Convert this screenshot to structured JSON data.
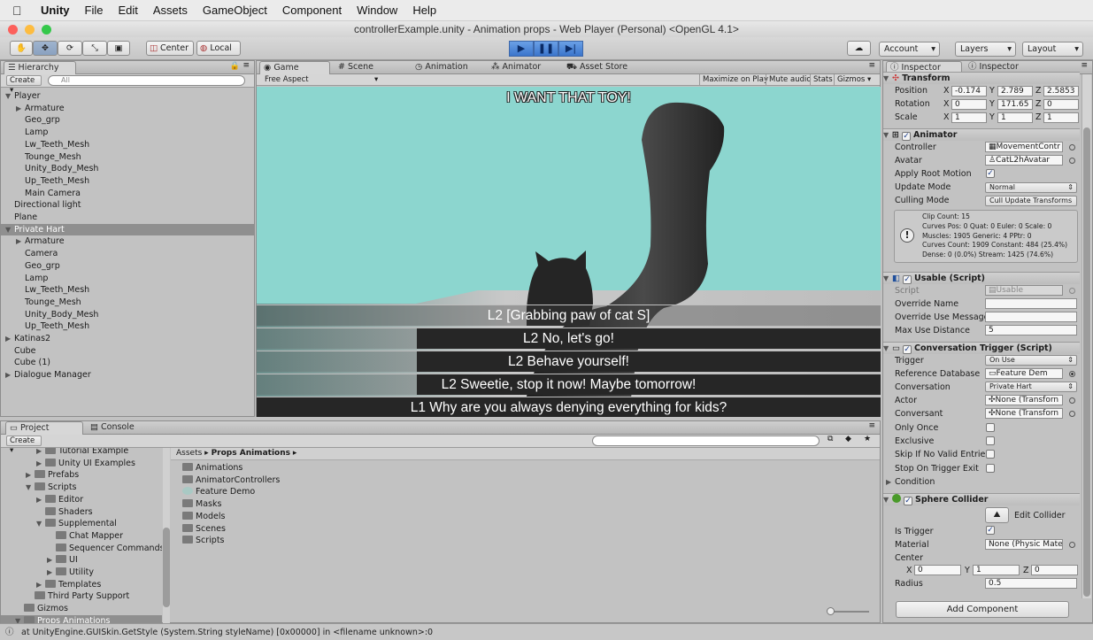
{
  "menubar": {
    "apple": "",
    "app": "Unity",
    "items": [
      "File",
      "Edit",
      "Assets",
      "GameObject",
      "Component",
      "Window",
      "Help"
    ]
  },
  "window_title": "controllerExample.unity - Animation props - Web Player (Personal) <OpenGL 4.1>",
  "toolbar": {
    "pivot": "Center",
    "space": "Local",
    "account": "Account",
    "layers": "Layers",
    "layout": "Layout"
  },
  "hierarchy": {
    "tab": "Hierarchy",
    "create": "Create",
    "search_placeholder": "All",
    "items": [
      {
        "label": "Player",
        "level": 0,
        "arrow": "▼",
        "selected": false
      },
      {
        "label": "Armature",
        "level": 1,
        "arrow": "▶",
        "selected": false
      },
      {
        "label": "Geo_grp",
        "level": 1,
        "arrow": "",
        "selected": false
      },
      {
        "label": "Lamp",
        "level": 1,
        "arrow": "",
        "selected": false
      },
      {
        "label": "Lw_Teeth_Mesh",
        "level": 1,
        "arrow": "",
        "selected": false
      },
      {
        "label": "Tounge_Mesh",
        "level": 1,
        "arrow": "",
        "selected": false
      },
      {
        "label": "Unity_Body_Mesh",
        "level": 1,
        "arrow": "",
        "selected": false
      },
      {
        "label": "Up_Teeth_Mesh",
        "level": 1,
        "arrow": "",
        "selected": false
      },
      {
        "label": "Main Camera",
        "level": 1,
        "arrow": "",
        "selected": false
      },
      {
        "label": "Directional light",
        "level": 0,
        "arrow": "",
        "selected": false
      },
      {
        "label": "Plane",
        "level": 0,
        "arrow": "",
        "selected": false
      },
      {
        "label": "Private Hart",
        "level": 0,
        "arrow": "▼",
        "selected": true
      },
      {
        "label": "Armature",
        "level": 1,
        "arrow": "▶",
        "selected": false
      },
      {
        "label": "Camera",
        "level": 1,
        "arrow": "",
        "selected": false
      },
      {
        "label": "Geo_grp",
        "level": 1,
        "arrow": "",
        "selected": false
      },
      {
        "label": "Lamp",
        "level": 1,
        "arrow": "",
        "selected": false
      },
      {
        "label": "Lw_Teeth_Mesh",
        "level": 1,
        "arrow": "",
        "selected": false
      },
      {
        "label": "Tounge_Mesh",
        "level": 1,
        "arrow": "",
        "selected": false
      },
      {
        "label": "Unity_Body_Mesh",
        "level": 1,
        "arrow": "",
        "selected": false
      },
      {
        "label": "Up_Teeth_Mesh",
        "level": 1,
        "arrow": "",
        "selected": false
      },
      {
        "label": "Katinas2",
        "level": 0,
        "arrow": "▶",
        "selected": false
      },
      {
        "label": "Cube",
        "level": 0,
        "arrow": "",
        "selected": false
      },
      {
        "label": "Cube (1)",
        "level": 0,
        "arrow": "",
        "selected": false
      },
      {
        "label": "Dialogue Manager",
        "level": 0,
        "arrow": "▶",
        "selected": false
      }
    ]
  },
  "center_tabs": {
    "game": "Game",
    "scene": "Scene",
    "animation": "Animation",
    "animator": "Animator",
    "asset_store": "Asset Store"
  },
  "game_bar": {
    "aspect": "Free Aspect",
    "maximize": "Maximize on Play",
    "mute": "Mute audio",
    "stats": "Stats",
    "gizmos": "Gizmos"
  },
  "game": {
    "subtitle": "I WANT THAT TOY!",
    "choices": [
      "L2 [Grabbing paw of cat S]",
      "L2 No, let's go!",
      "L2 Behave yourself!",
      "L2 Sweetie, stop it now! Maybe tomorrow!",
      "L1 Why are you always denying everything for kids?"
    ]
  },
  "inspector": {
    "tab1": "Inspector",
    "tab2": "Inspector",
    "transform": {
      "title": "Transform",
      "position_label": "Position",
      "rotation_label": "Rotation",
      "scale_label": "Scale",
      "position": [
        "-0.174",
        "2.789",
        "2.5853"
      ],
      "rotation": [
        "0",
        "171.65",
        "0"
      ],
      "scale": [
        "1",
        "1",
        "1"
      ],
      "x": "X",
      "y": "Y",
      "z": "Z"
    },
    "animator": {
      "title": "Animator",
      "controller_label": "Controller",
      "controller": "MovementContr",
      "avatar_label": "Avatar",
      "avatar": "CatL2hAvatar",
      "root_motion_label": "Apply Root Motion",
      "update_mode_label": "Update Mode",
      "update_mode": "Normal",
      "culling_label": "Culling Mode",
      "culling": "Cull Update Transforms",
      "info": [
        "Clip Count: 15",
        "Curves Pos: 0 Quat: 0 Euler: 0 Scale: 0",
        "Muscles: 1905 Generic: 4 PPtr: 0",
        "Curves Count: 1909 Constant: 484 (25.4%)",
        "Dense: 0 (0.0%) Stream: 1425 (74.6%)"
      ]
    },
    "usable": {
      "title": "Usable (Script)",
      "script_label": "Script",
      "script": "Usable",
      "override_name_label": "Override Name",
      "override_name": "",
      "override_msg_label": "Override Use Message",
      "override_msg": "",
      "max_dist_label": "Max Use Distance",
      "max_dist": "5"
    },
    "conversation_trigger": {
      "title": "Conversation Trigger (Script)",
      "trigger_label": "Trigger",
      "trigger": "On Use",
      "refdb_label": "Reference Database",
      "refdb": "Feature Dem",
      "conversation_label": "Conversation",
      "conversation": "Private Hart",
      "actor_label": "Actor",
      "actor": "None (Transforn",
      "conversant_label": "Conversant",
      "conversant": "None (Transforn",
      "only_once_label": "Only Once",
      "exclusive_label": "Exclusive",
      "skip_label": "Skip If No Valid Entries",
      "stop_label": "Stop On Trigger Exit",
      "condition_label": "Condition"
    },
    "sphere_collider": {
      "title": "Sphere Collider",
      "edit_label": "Edit Collider",
      "is_trigger_label": "Is Trigger",
      "material_label": "Material",
      "material": "None (Physic Mater",
      "center_label": "Center",
      "center": [
        "0",
        "1",
        "0"
      ],
      "radius_label": "Radius",
      "radius": "0.5"
    },
    "add_component": "Add Component"
  },
  "project": {
    "tab": "Project",
    "console_tab": "Console",
    "create": "Create",
    "tree": [
      {
        "label": "Tutorial Example",
        "level": 3,
        "arrow": "▶"
      },
      {
        "label": "Unity UI Examples",
        "level": 3,
        "arrow": "▶"
      },
      {
        "label": "Prefabs",
        "level": 2,
        "arrow": "▶"
      },
      {
        "label": "Scripts",
        "level": 2,
        "arrow": "▼"
      },
      {
        "label": "Editor",
        "level": 3,
        "arrow": "▶"
      },
      {
        "label": "Shaders",
        "level": 3,
        "arrow": ""
      },
      {
        "label": "Supplemental",
        "level": 3,
        "arrow": "▼"
      },
      {
        "label": "Chat Mapper",
        "level": 4,
        "arrow": ""
      },
      {
        "label": "Sequencer Commands",
        "level": 4,
        "arrow": ""
      },
      {
        "label": "UI",
        "level": 4,
        "arrow": "▶"
      },
      {
        "label": "Utility",
        "level": 4,
        "arrow": "▶"
      },
      {
        "label": "Templates",
        "level": 3,
        "arrow": "▶"
      },
      {
        "label": "Third Party Support",
        "level": 2,
        "arrow": ""
      },
      {
        "label": "Gizmos",
        "level": 1,
        "arrow": ""
      },
      {
        "label": "Props Animations",
        "level": 1,
        "arrow": "▼"
      }
    ],
    "breadcrumb_root": "Assets",
    "breadcrumb_current": "Props Animations",
    "assets": [
      "Animations",
      "AnimatorControllers",
      "Feature Demo",
      "Masks",
      "Models",
      "Scenes",
      "Scripts"
    ]
  },
  "status": "at UnityEngine.GUISkin.GetStyle (System.String styleName) [0x00000] in <filename unknown>:0"
}
